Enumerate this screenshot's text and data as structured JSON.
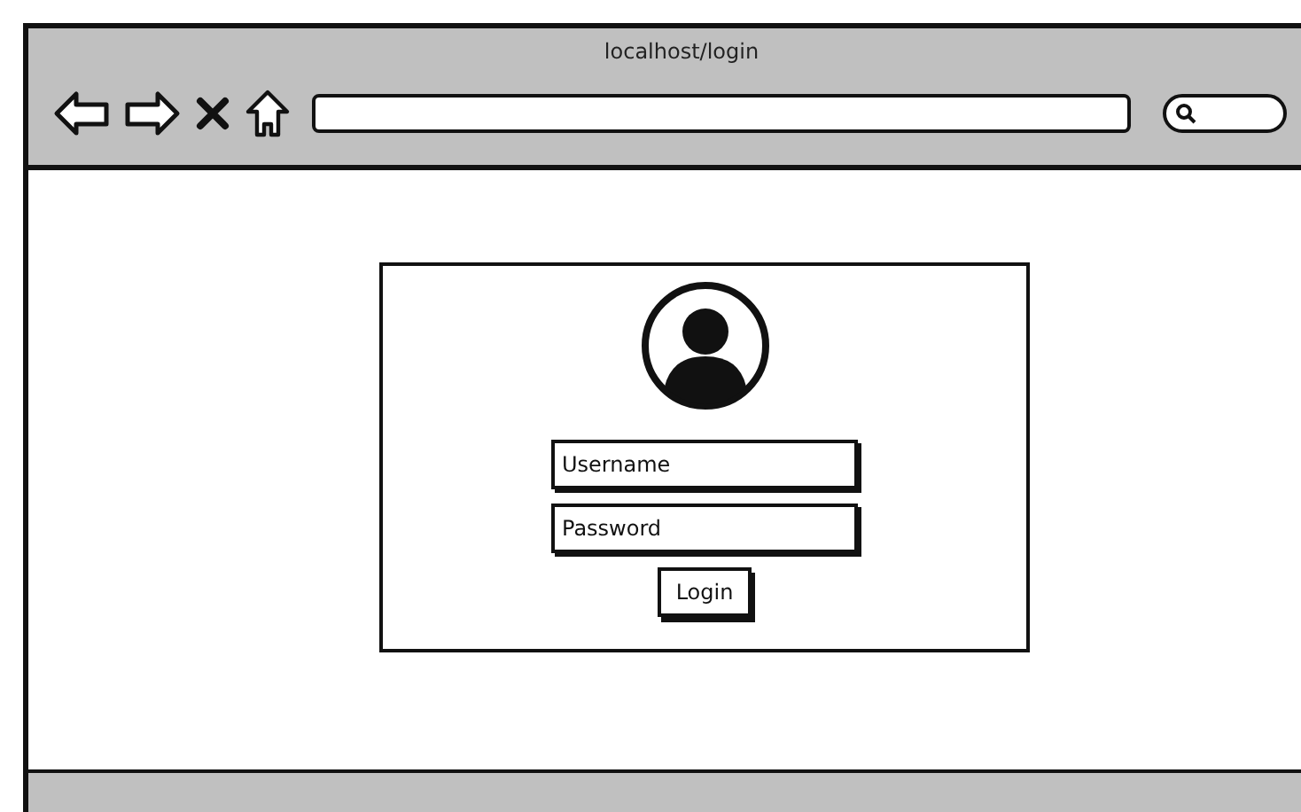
{
  "window": {
    "title": "localhost/login"
  },
  "login_form": {
    "username": {
      "placeholder": "Username"
    },
    "password": {
      "placeholder": "Password"
    },
    "button": "Login"
  }
}
